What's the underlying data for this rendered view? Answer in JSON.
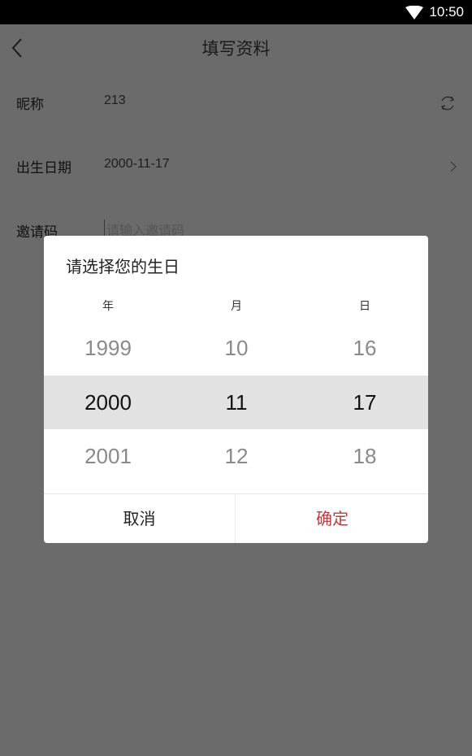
{
  "status_bar": {
    "time": "10:50",
    "icons": [
      "wifi-icon"
    ]
  },
  "header": {
    "title": "填写资料",
    "back_icon": "chevron-left-icon"
  },
  "form": {
    "nickname": {
      "label": "昵称",
      "value": "213",
      "icon": "refresh-icon"
    },
    "birthday": {
      "label": "出生日期",
      "value": "2000-11-17",
      "icon": "chevron-right-icon"
    },
    "invite": {
      "label": "邀请码",
      "placeholder": "请输入邀请码",
      "value": ""
    }
  },
  "dialog": {
    "title": "请选择您的生日",
    "columns": {
      "year": "年",
      "month": "月",
      "day": "日"
    },
    "rows": {
      "prev": {
        "year": "1999",
        "month": "10",
        "day": "16"
      },
      "selected": {
        "year": "2000",
        "month": "11",
        "day": "17"
      },
      "next": {
        "year": "2001",
        "month": "12",
        "day": "18"
      }
    },
    "cancel_label": "取消",
    "confirm_label": "确定",
    "colors": {
      "confirm": "#c0393b",
      "selected_band": "#e2e2e2"
    }
  },
  "colors": {
    "overlay": "#6b6b6b",
    "status_bar": "#000000"
  }
}
